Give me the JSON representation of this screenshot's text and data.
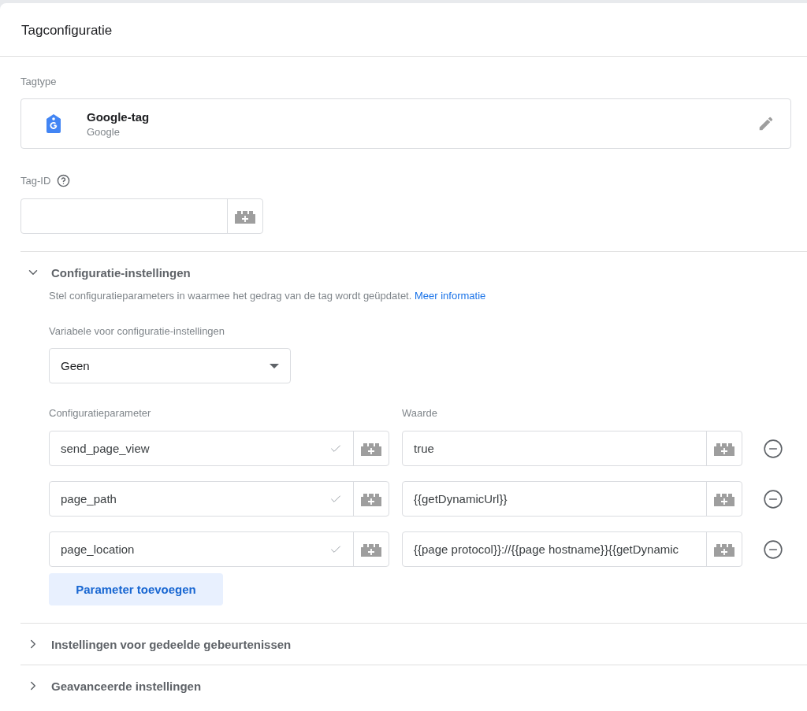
{
  "title": "Tagconfiguratie",
  "tag_type": {
    "label": "Tagtype",
    "name": "Google-tag",
    "vendor": "Google"
  },
  "tag_id": {
    "label": "Tag-ID"
  },
  "sections": [
    {
      "title": "Configuratie-instellingen",
      "expanded": true,
      "description": "Stel configuratieparameters in waarmee het gedrag van de tag wordt geüpdatet.",
      "link": "Meer informatie",
      "variable_label": "Variabele voor configuratie-instellingen",
      "variable_value": "Geen",
      "param_header": "Configuratieparameter",
      "value_header": "Waarde",
      "parameters": [
        {
          "name": "send_page_view",
          "valid": true,
          "value": "true"
        },
        {
          "name": "page_path",
          "valid": true,
          "value": "{{getDynamicUrl}}"
        },
        {
          "name": "page_location",
          "valid": true,
          "value": "{{page protocol}}://{{page hostname}}{{getDynamic"
        }
      ],
      "add_button": "Parameter toevoegen"
    },
    {
      "title": "Instellingen voor gedeelde gebeurtenissen",
      "expanded": false
    },
    {
      "title": "Geavanceerde instellingen",
      "expanded": false
    }
  ]
}
